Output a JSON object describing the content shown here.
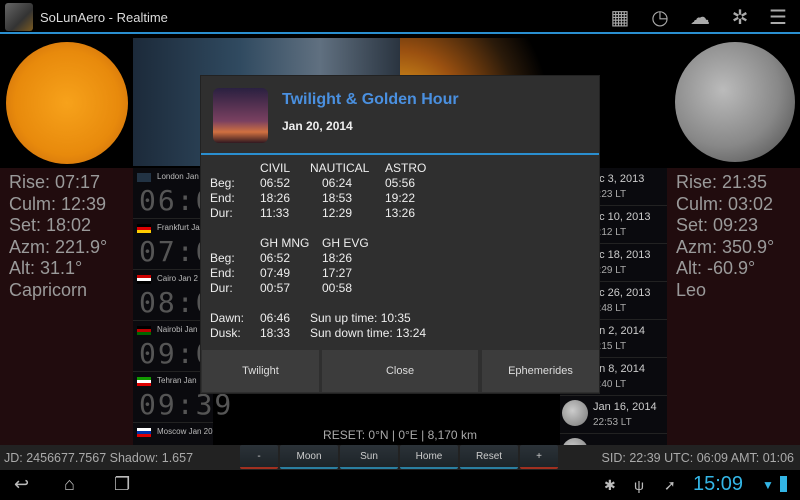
{
  "app": {
    "title": "SoLunAero - Realtime",
    "toolbar_icons": [
      "calendar-icon",
      "clock-icon",
      "cloud-icon",
      "satellite-icon",
      "settings-sliders-icon"
    ]
  },
  "sun": {
    "rise": "Rise: 07:17",
    "culm": "Culm: 12:39",
    "set": "Set: 18:02",
    "azm": "Azm: 221.9°",
    "alt": "Alt: 31.1°",
    "sign": "Capricorn"
  },
  "moon": {
    "rise": "Rise: 21:35",
    "culm": "Culm: 03:02",
    "set": "Set: 09:23",
    "azm": "Azm: 350.9°",
    "alt": "Alt: -60.9°",
    "sign": "Leo"
  },
  "clocks": [
    {
      "city": "London Jan",
      "time": "06:0",
      "flag": "uk"
    },
    {
      "city": "Frankfurt Ja",
      "time": "07:0",
      "flag": "de"
    },
    {
      "city": "Cairo Jan 2",
      "time": "08:0",
      "flag": "eg"
    },
    {
      "city": "Nairobi Jan",
      "time": "09:0",
      "flag": "ke"
    },
    {
      "city": "Tehran Jan",
      "time": "09:39",
      "flag": "ir"
    },
    {
      "city": "Moscow Jan 20",
      "time": "",
      "flag": "ru"
    }
  ],
  "moon_phases": [
    {
      "date": "ec 3, 2013",
      "time": "3:23 LT"
    },
    {
      "date": "ec 10, 2013",
      "time": "9:12 LT"
    },
    {
      "date": "ec 18, 2013",
      "time": "3:29 LT"
    },
    {
      "date": "ec 26, 2013",
      "time": "7:48 LT"
    },
    {
      "date": "an 2, 2014",
      "time": "5:15 LT"
    },
    {
      "date": "an 8, 2014",
      "time": "1:40 LT"
    },
    {
      "date": "Jan 16, 2014",
      "time": "22:53 LT"
    }
  ],
  "map": {
    "reset_text": "RESET: 0°N | 0°E | 8,170 km"
  },
  "status": {
    "jd": "JD: 2456677.7567  Shadow: 1.657",
    "sid": "SID: 22:39  UTC: 06:09  AMT: 01:06"
  },
  "controls": {
    "minus": "-",
    "moon": "Moon",
    "sun": "Sun",
    "home": "Home",
    "reset": "Reset",
    "plus": "+"
  },
  "system": {
    "time": "15:09"
  },
  "dialog": {
    "title": "Twilight & Golden Hour",
    "date": "Jan 20, 2014",
    "twilight": {
      "headers": [
        "CIVIL",
        "NAUTICAL",
        "ASTRO"
      ],
      "rows": [
        {
          "label": "Beg:",
          "values": [
            "06:52",
            "06:24",
            "05:56"
          ]
        },
        {
          "label": "End:",
          "values": [
            "18:26",
            "18:53",
            "19:22"
          ]
        },
        {
          "label": "Dur:",
          "values": [
            "11:33",
            "12:29",
            "13:26"
          ]
        }
      ]
    },
    "golden": {
      "headers": [
        "GH MNG",
        "GH EVG"
      ],
      "rows": [
        {
          "label": "Beg:",
          "values": [
            "06:52",
            "18:26"
          ]
        },
        {
          "label": "End:",
          "values": [
            "07:49",
            "17:27"
          ]
        },
        {
          "label": "Dur:",
          "values": [
            "00:57",
            "00:58"
          ]
        }
      ]
    },
    "dawn_label": "Dawn:",
    "dawn": "06:46",
    "sun_up": "Sun up time: 10:35",
    "dusk_label": "Dusk:",
    "dusk": "18:33",
    "sun_down": "Sun down time: 13:24",
    "buttons": {
      "twilight": "Twilight",
      "close": "Close",
      "ephemerides": "Ephemerides"
    }
  },
  "colors": {
    "accent": "#2a8fd0",
    "title": "#4a90e0",
    "panel": "#210c0e"
  }
}
